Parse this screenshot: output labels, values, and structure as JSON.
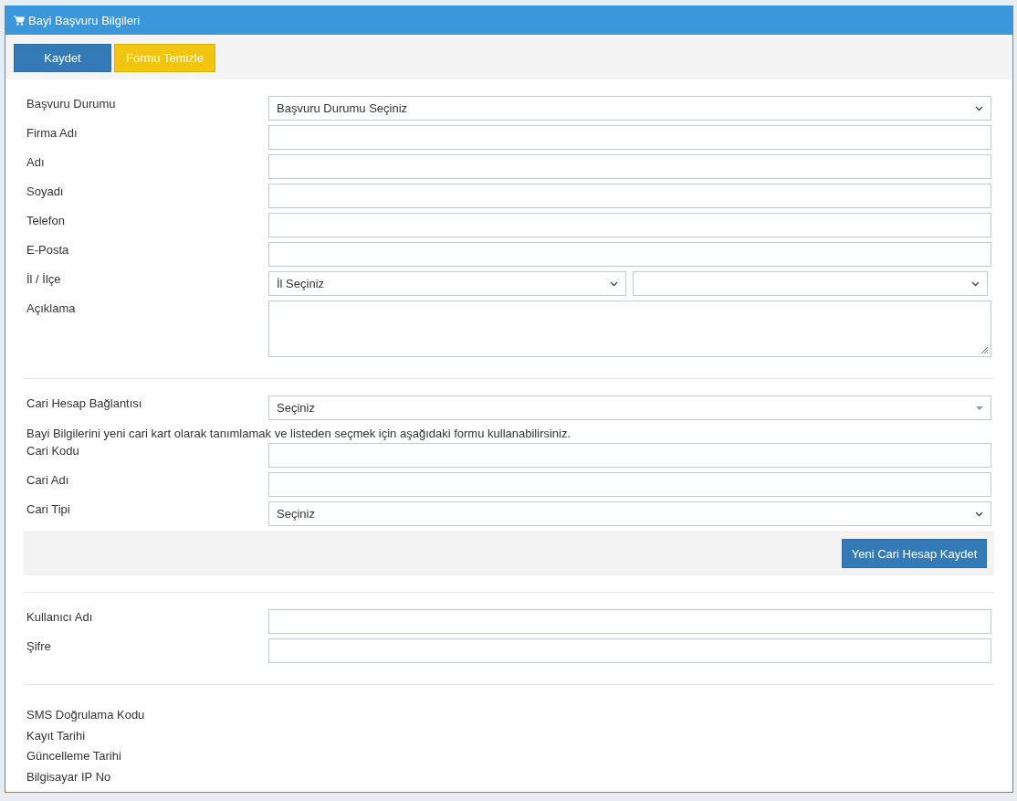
{
  "panel": {
    "title": "Bayi Başvuru Bilgileri"
  },
  "toolbar": [
    {
      "label": "Kaydet",
      "kind": "primary"
    },
    {
      "label": "Formu Temizle",
      "kind": "warning"
    }
  ],
  "sections": [
    {
      "rows": [
        {
          "label": "Başvuru Durumu",
          "kind": "select",
          "value": "Başvuru Durumu Seçiniz"
        },
        {
          "label": "Firma Adı",
          "kind": "text"
        },
        {
          "label": "Adı",
          "kind": "text"
        },
        {
          "label": "Soyadı",
          "kind": "text"
        },
        {
          "label": "Telefon",
          "kind": "text"
        },
        {
          "label": "E-Posta",
          "kind": "text"
        },
        {
          "label": "İl / İlçe",
          "kind": "select-pair",
          "value": "İl Seçiniz"
        },
        {
          "label": "Açıklama",
          "kind": "textarea"
        }
      ]
    },
    {
      "rows": [
        {
          "label": "Cari Hesap Bağlantısı",
          "kind": "combo",
          "value": "Seçiniz"
        },
        {
          "kind": "note",
          "text": "Bayi Bilgilerini yeni cari kart olarak tanımlamak ve listeden seçmek için aşağıdaki formu kullanabilirsiniz."
        },
        {
          "label": "Cari Kodu",
          "kind": "text"
        },
        {
          "label": "Cari Adı",
          "kind": "text"
        },
        {
          "label": "Cari Tipi",
          "kind": "select",
          "value": "Seçiniz"
        }
      ],
      "footer_button": "Yeni Cari Hesap Kaydet"
    },
    {
      "rows": [
        {
          "label": "Kullanıcı Adı",
          "kind": "text"
        },
        {
          "label": "Şifre",
          "kind": "password"
        }
      ]
    },
    {
      "rows": [
        {
          "label": "SMS Doğrulama Kodu",
          "kind": "info"
        },
        {
          "label": "Kayıt Tarihi",
          "kind": "info"
        },
        {
          "label": "Güncelleme Tarihi",
          "kind": "info"
        },
        {
          "label": "Bilgisayar IP No",
          "kind": "info"
        }
      ]
    }
  ]
}
